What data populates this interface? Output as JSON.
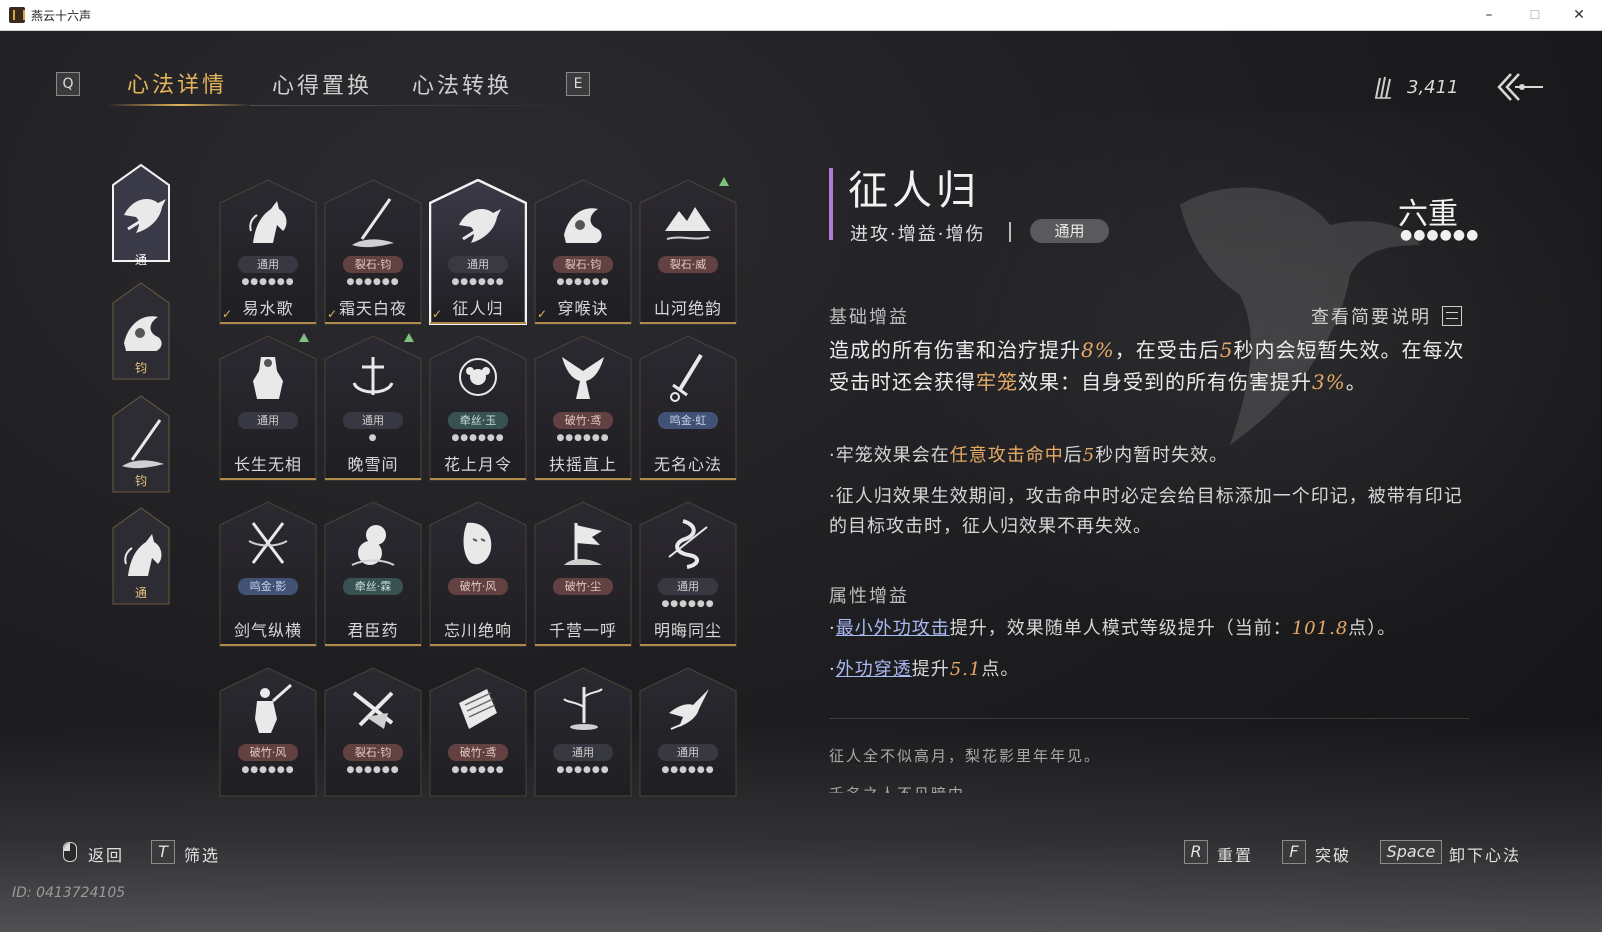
{
  "window": {
    "title": "燕云十六声",
    "min": "–",
    "max": "☐",
    "close": "✕"
  },
  "tabs": {
    "prev_key": "Q",
    "next_key": "E",
    "items": [
      "心法详情",
      "心得置换",
      "心法转换"
    ],
    "active": 0
  },
  "currency": {
    "value": "3,411",
    "icon": "feather-currency-icon"
  },
  "equipped": [
    {
      "label": "通",
      "emblem": "crow",
      "selected": true
    },
    {
      "label": "钧",
      "emblem": "wave",
      "selected": false
    },
    {
      "label": "钧",
      "emblem": "spear",
      "selected": false
    },
    {
      "label": "通",
      "emblem": "horse",
      "selected": false
    }
  ],
  "grid": [
    {
      "name": "易水歌",
      "tag": "通用",
      "tag_style": "grey",
      "dots": "●●●●●●",
      "equipped": true,
      "upgrade": false,
      "emblem": "horse"
    },
    {
      "name": "霜天白夜",
      "tag": "裂石·钧",
      "tag_style": "red",
      "dots": "●●●●●●",
      "equipped": true,
      "upgrade": false,
      "emblem": "spear"
    },
    {
      "name": "征人归",
      "tag": "通用",
      "tag_style": "grey",
      "dots": "●●●●●●",
      "equipped": true,
      "upgrade": false,
      "emblem": "crow",
      "selected": true
    },
    {
      "name": "穿喉诀",
      "tag": "裂石·钧",
      "tag_style": "red",
      "dots": "●●●●●●",
      "equipped": true,
      "upgrade": false,
      "emblem": "wave"
    },
    {
      "name": "山河绝韵",
      "tag": "裂石·威",
      "tag_style": "red",
      "dots": "",
      "equipped": false,
      "upgrade": true,
      "emblem": "mountain"
    },
    {
      "name": "长生无相",
      "tag": "通用",
      "tag_style": "grey",
      "dots": "",
      "equipped": false,
      "upgrade": true,
      "emblem": "statue"
    },
    {
      "name": "晚雪间",
      "tag": "通用",
      "tag_style": "grey",
      "dots": "●",
      "equipped": false,
      "upgrade": true,
      "emblem": "anchor"
    },
    {
      "name": "花上月令",
      "tag": "牵丝·玉",
      "tag_style": "teal",
      "dots": "●●●●●●",
      "equipped": false,
      "upgrade": false,
      "emblem": "flower"
    },
    {
      "name": "扶摇直上",
      "tag": "破竹·鸢",
      "tag_style": "red",
      "dots": "●●●●●●",
      "equipped": false,
      "upgrade": false,
      "emblem": "eagle"
    },
    {
      "name": "无名心法",
      "tag": "鸣金·虹",
      "tag_style": "blue",
      "dots": "",
      "equipped": false,
      "upgrade": false,
      "emblem": "sword"
    },
    {
      "name": "剑气纵横",
      "tag": "鸣金·影",
      "tag_style": "blue",
      "dots": "",
      "equipped": false,
      "upgrade": false,
      "emblem": "swords"
    },
    {
      "name": "君臣药",
      "tag": "牵丝·霖",
      "tag_style": "teal",
      "dots": "",
      "equipped": false,
      "upgrade": false,
      "emblem": "gourd"
    },
    {
      "name": "忘川绝响",
      "tag": "破竹·风",
      "tag_style": "red",
      "dots": "",
      "equipped": false,
      "upgrade": false,
      "emblem": "mask"
    },
    {
      "name": "千营一呼",
      "tag": "破竹·尘",
      "tag_style": "red",
      "dots": "",
      "equipped": false,
      "upgrade": false,
      "emblem": "flag"
    },
    {
      "name": "明晦同尘",
      "tag": "通用",
      "tag_style": "grey",
      "dots": "●●●●●●",
      "equipped": false,
      "upgrade": false,
      "emblem": "snake"
    },
    {
      "name": "",
      "tag": "破竹·风",
      "tag_style": "red",
      "dots": "●●●●●●",
      "equipped": false,
      "upgrade": false,
      "emblem": "warrior"
    },
    {
      "name": "",
      "tag": "裂石·钧",
      "tag_style": "red",
      "dots": "●●●●●●",
      "equipped": false,
      "upgrade": false,
      "emblem": "blades"
    },
    {
      "name": "",
      "tag": "破竹·鸢",
      "tag_style": "red",
      "dots": "●●●●●●",
      "equipped": false,
      "upgrade": false,
      "emblem": "scroll"
    },
    {
      "name": "",
      "tag": "通用",
      "tag_style": "grey",
      "dots": "●●●●●●",
      "equipped": false,
      "upgrade": false,
      "emblem": "bamboo"
    },
    {
      "name": "",
      "tag": "通用",
      "tag_style": "grey",
      "dots": "●●●●●●",
      "equipped": false,
      "upgrade": false,
      "emblem": "swallow"
    }
  ],
  "detail": {
    "title": "征人归",
    "tags": "进攻·增益·增伤",
    "type": "通用",
    "level": "六重",
    "level_dots": "●●●●●●",
    "base_title": "基础增益",
    "view_desc": "查看简要说明",
    "main_a": "造成的所有伤害和治疗提升",
    "main_v1": "8%",
    "main_b": "，在受击后",
    "main_v2": "5",
    "main_c": "秒内会短暂失效。在每次受击时还会获得",
    "main_kw": "牢笼",
    "main_d": "效果：自身受到的所有伤害提升",
    "main_v3": "3%",
    "main_e": "。",
    "sub1_a": "·牢笼效果会在",
    "sub1_kw": "任意攻击命中",
    "sub1_b": "后",
    "sub1_v": "5",
    "sub1_c": "秒内暂时失效。",
    "sub2": "·征人归效果生效期间，攻击命中时必定会给目标添加一个印记，被带有印记的目标攻击时，征人归效果不再失效。",
    "attr_title": "属性增益",
    "attr1_a": "·",
    "attr1_link": "最小外功攻击",
    "attr1_b": "提升，效果随单人模式等级提升（当前：",
    "attr1_v": "101.8",
    "attr1_c": "点）。",
    "attr2_a": "·",
    "attr2_link": "外功穿透",
    "attr2_b": "提升",
    "attr2_v": "5.1",
    "attr2_c": "点。",
    "flavor1": "征人全不似高月，梨花影里年年见。",
    "flavor2": "千名之人不见暗中"
  },
  "bottom": {
    "back_label": "返回",
    "filter_key": "T",
    "filter_label": "筛选",
    "reset_key": "R",
    "reset_label": "重置",
    "break_key": "F",
    "break_label": "突破",
    "unequip_key": "Space",
    "unequip_label": "卸下心法"
  },
  "uid": "ID: 0413724105",
  "colors": {
    "accent": "#e4b35c",
    "highlight": "#e7a966",
    "link": "#a9b9f2",
    "purple_bar": "#b07ad8"
  }
}
